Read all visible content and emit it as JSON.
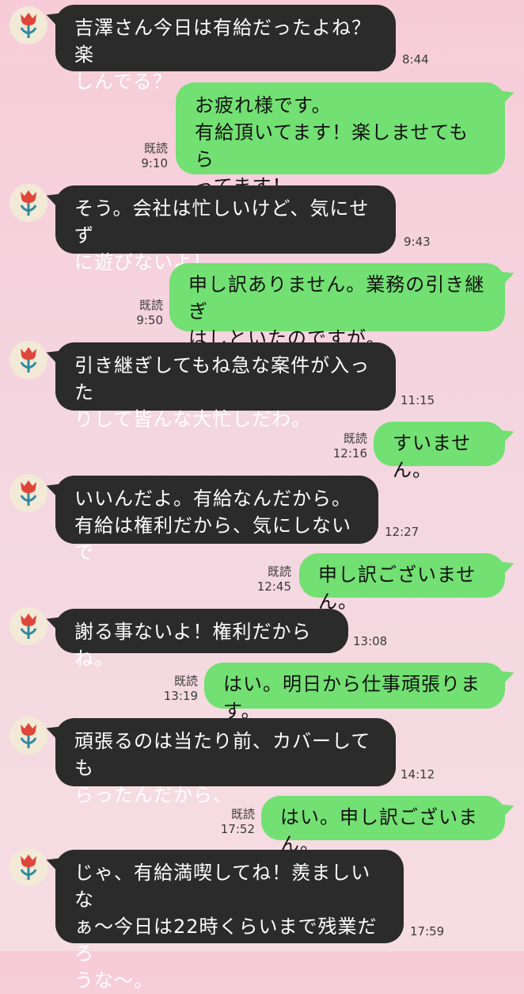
{
  "messages": [
    {
      "from": "contact",
      "text": "吉澤さん今日は有給だったよね？楽\nしんでる？",
      "time": "8:44"
    },
    {
      "from": "me",
      "text": "お疲れ様です。\n有給頂いてます！楽しませてもら\nってます！",
      "read": "既読",
      "time": "9:10"
    },
    {
      "from": "contact",
      "text": "そう。会社は忙しいけど、気にせず\nに遊びないよ！",
      "time": "9:43"
    },
    {
      "from": "me",
      "text": "申し訳ありません。業務の引き継ぎ\nはしといたのですが。",
      "read": "既読",
      "time": "9:50"
    },
    {
      "from": "contact",
      "text": "引き継ぎしてもね急な案件が入った\nりして皆んな大忙しだわ。",
      "time": "11:15"
    },
    {
      "from": "me",
      "text": "すいません。",
      "read": "既読",
      "time": "12:16"
    },
    {
      "from": "contact",
      "text": "いいんだよ。有給なんだから。\n有給は権利だから、気にしないで",
      "time": "12:27"
    },
    {
      "from": "me",
      "text": "申し訳ございません。",
      "read": "既読",
      "time": "12:45"
    },
    {
      "from": "contact",
      "text": "謝る事ないよ！権利だからね。",
      "time": "13:08"
    },
    {
      "from": "me",
      "text": "はい。明日から仕事頑張ります。",
      "read": "既読",
      "time": "13:19"
    },
    {
      "from": "contact",
      "text": "頑張るのは当たり前、カバーしても\nらったんだから、",
      "time": "14:12"
    },
    {
      "from": "me",
      "text": "はい。申し訳ございまん。",
      "read": "既読",
      "time": "17:52"
    },
    {
      "from": "contact",
      "text": "じゃ、有給満喫してね！羨ましいな\nぁ〜今日は22時くらいまで残業だろ\nうな〜。",
      "time": "17:59"
    }
  ],
  "avatar_icon": "tulip-icon",
  "colors": {
    "received_bubble": "#2b2b2b",
    "sent_bubble": "#72e072",
    "background": "#f7ccd8",
    "avatar_bg": "#f2e9d6",
    "flower": "#e0453a",
    "stem": "#2f8aa0"
  }
}
